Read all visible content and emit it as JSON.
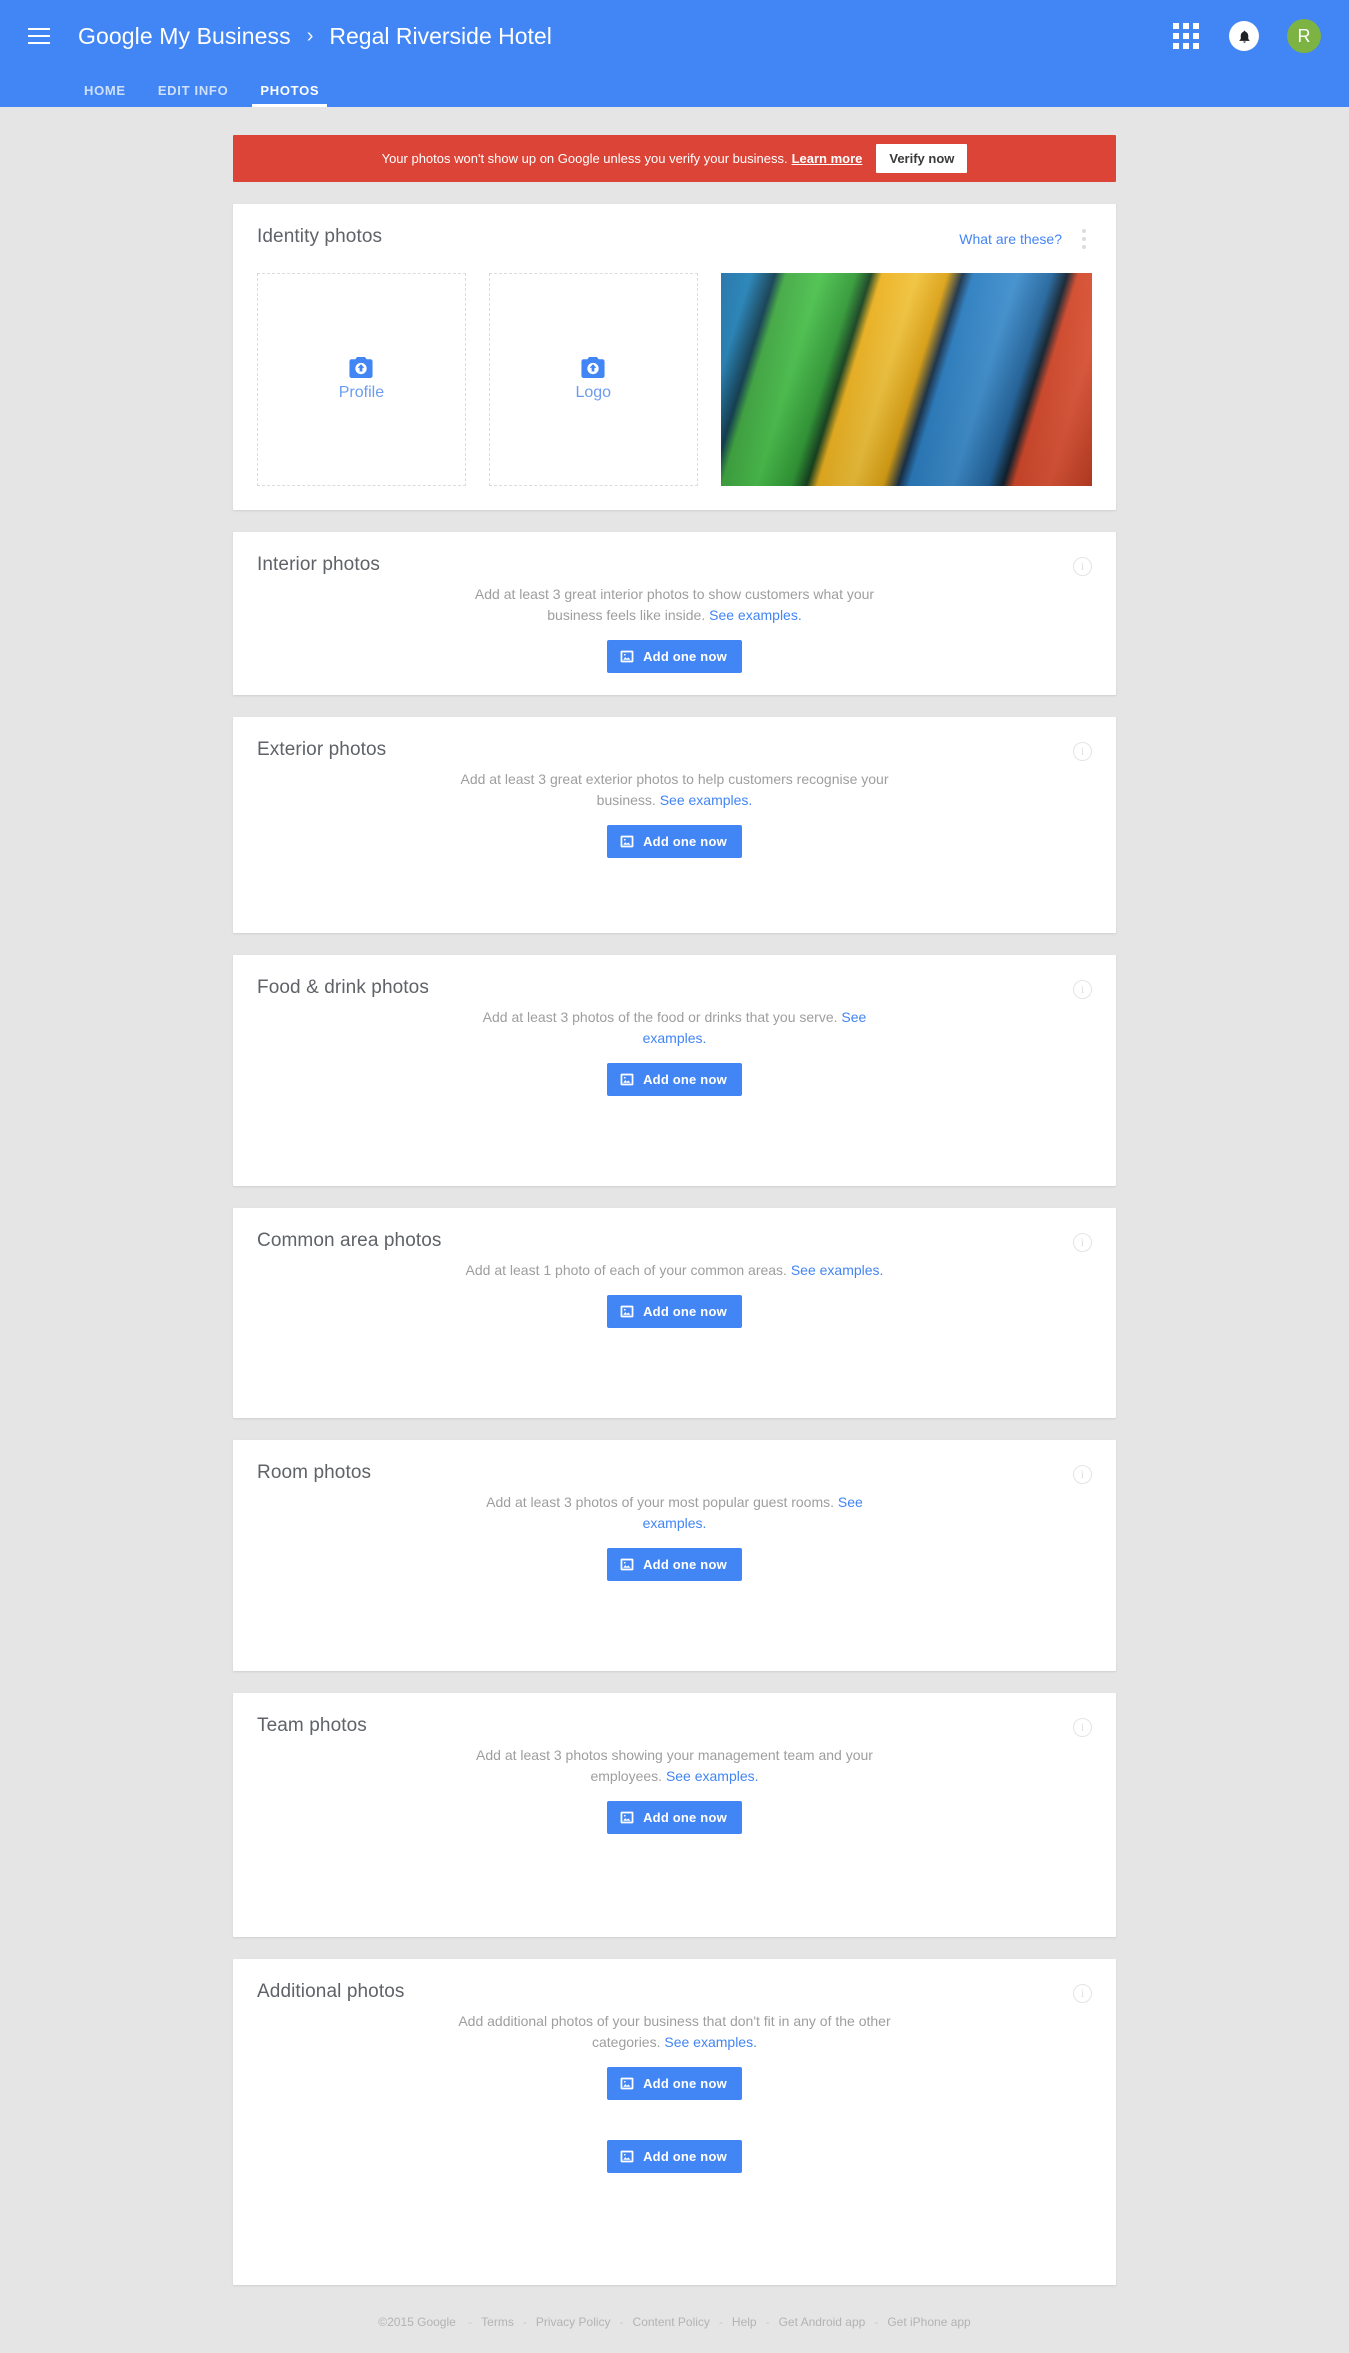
{
  "topbar": {
    "menu_icon": "hamburger-menu-icon",
    "brand": "Google My Business",
    "breadcrumb_separator": "›",
    "business_name": "Regal Riverside Hotel",
    "apps_icon": "apps-grid-icon",
    "notifications_icon": "bell-icon",
    "avatar_initial": "R",
    "avatar_color": "#7cb342",
    "bar_color": "#4285f4",
    "tabs": [
      {
        "label": "HOME",
        "active": false
      },
      {
        "label": "EDIT INFO",
        "active": false
      },
      {
        "label": "PHOTOS",
        "active": true
      }
    ]
  },
  "banner": {
    "color": "#db4437",
    "text": "Your photos won't show up on Google unless you verify your business.",
    "learn_more": "Learn more",
    "button": "Verify now"
  },
  "identity": {
    "title": "Identity photos",
    "what_are_these": "What are these?",
    "overflow_icon": "kebab-menu-icon",
    "tiles": [
      {
        "label": "Profile",
        "icon": "camera-upload-icon"
      },
      {
        "label": "Logo",
        "icon": "camera-upload-icon"
      }
    ],
    "photo_alt": "colored-paper-sheets-photo"
  },
  "sections": [
    {
      "title": "Interior photos",
      "desc_before": "Add at least 3 great interior photos to show customers what your business feels like inside. ",
      "link": "See examples.",
      "button": "Add one now",
      "info_icon": "info-icon",
      "pad": "card-pad-sm"
    },
    {
      "title": "Exterior photos",
      "desc_before": "Add at least 3 great exterior photos to help customers recognise your business. ",
      "link": "See examples.",
      "button": "Add one now",
      "info_icon": "info-icon",
      "pad": "card-pad-md"
    },
    {
      "title": "Food & drink photos",
      "desc_before": "Add at least 3 photos of the food or drinks that you serve. ",
      "link": "See examples.",
      "button": "Add one now",
      "info_icon": "info-icon",
      "pad": "card-pad-lg"
    },
    {
      "title": "Common area photos",
      "desc_before": "Add at least 1 photo of each of your common areas. ",
      "link": "See examples.",
      "button": "Add one now",
      "info_icon": "info-icon",
      "pad": "card-pad-lg"
    },
    {
      "title": "Room photos",
      "desc_before": "Add at least 3 photos of your most popular guest rooms. ",
      "link": "See examples.",
      "button": "Add one now",
      "info_icon": "info-icon",
      "pad": "card-pad-lg"
    },
    {
      "title": "Team photos",
      "desc_before": "Add at least 3 photos showing your management team and your employees. ",
      "link": "See examples.",
      "button": "Add one now",
      "info_icon": "info-icon",
      "pad": "card-pad-xl"
    },
    {
      "title": "Additional photos",
      "desc_before": "Add additional photos of your business that don't fit in any of the other categories. ",
      "link": "See examples.",
      "button": "Add one now",
      "button_secondary": "Add one now",
      "info_icon": "info-icon",
      "pad": "card-pad-xxl"
    }
  ],
  "footer": {
    "copyright": "©2015 Google",
    "links": [
      "Terms",
      "Privacy Policy",
      "Content Policy",
      "Help",
      "Get Android app",
      "Get iPhone app"
    ],
    "separator": "-"
  }
}
